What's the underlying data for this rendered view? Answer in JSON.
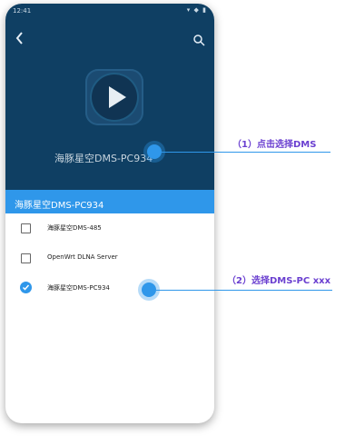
{
  "statusbar": {
    "time": "12:41",
    "icons": "▾ ◆ ▮"
  },
  "top": {
    "device_name": "海豚星空DMS-PC934"
  },
  "sheet": {
    "title": "海豚星空DMS-PC934",
    "items": [
      {
        "label": "海豚星空DMS-485",
        "selected": false
      },
      {
        "label": "OpenWrt DLNA Server",
        "selected": false
      },
      {
        "label": "海豚星空DMS-PC934",
        "selected": true
      }
    ]
  },
  "annotations": {
    "step1": "（1）点击选择DMS",
    "step2": "（2）选择DMS-PC xxx"
  },
  "colors": {
    "accent": "#2f97ea",
    "header_bg": "#0f3f63",
    "annotation": "#6a3fd0"
  }
}
